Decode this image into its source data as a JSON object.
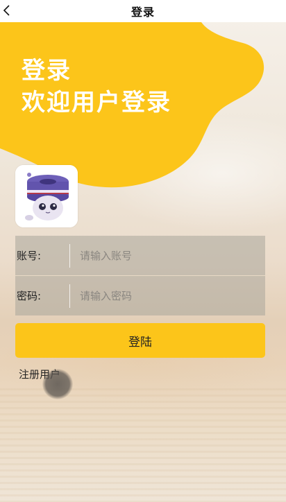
{
  "navbar": {
    "title": "登录",
    "back_icon": "chevron-left-icon"
  },
  "hero": {
    "line1": "登录",
    "line2": "欢迎用户登录"
  },
  "form": {
    "account": {
      "label": "账号:",
      "placeholder": "请输入账号",
      "value": ""
    },
    "password": {
      "label": "密码:",
      "placeholder": "请输入密码",
      "value": ""
    }
  },
  "actions": {
    "login_label": "登陆",
    "register_label": "注册用户"
  },
  "colors": {
    "accent": "#fcc51a",
    "field_bg": "#aaa59b"
  }
}
